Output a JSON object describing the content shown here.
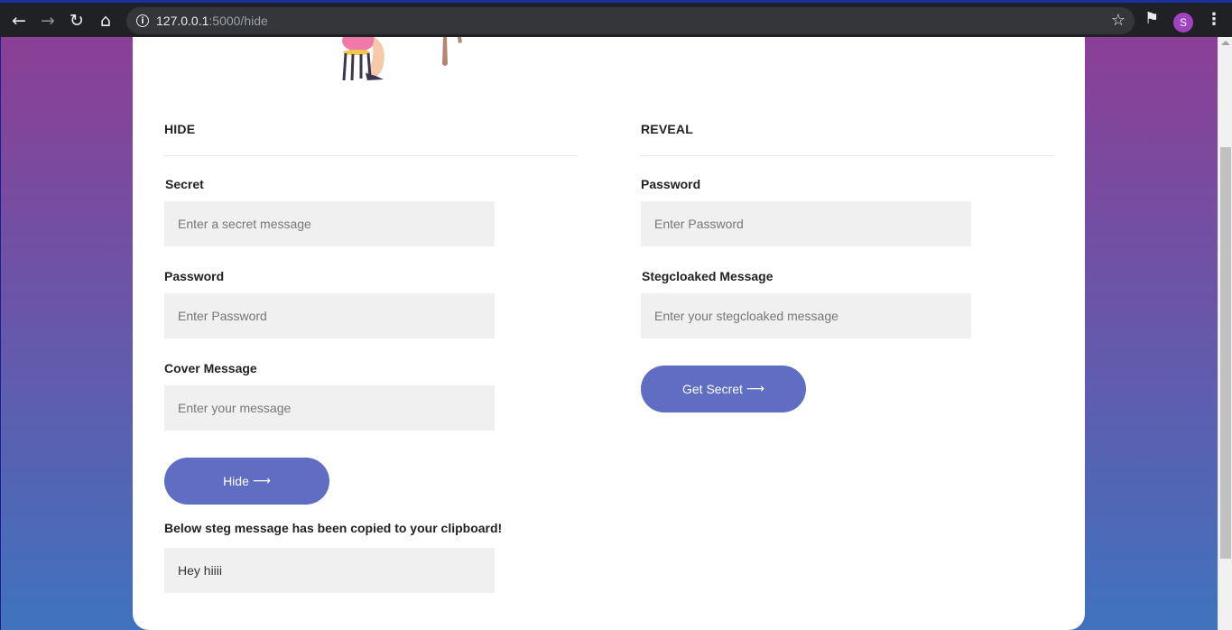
{
  "browser": {
    "url_host": "127.0.0.1",
    "url_path": ":5000/hide",
    "profile_initial": "S",
    "icons": {
      "back": "back-arrow-icon",
      "forward": "forward-arrow-icon",
      "reload": "reload-icon",
      "home": "home-icon",
      "info": "info-icon",
      "star": "star-icon",
      "extensions": "puzzle-icon",
      "menu": "kebab-menu-icon"
    }
  },
  "hide": {
    "title": "HIDE",
    "secret_label": "Secret",
    "secret_placeholder": "Enter a secret message",
    "password_label": "Password",
    "password_placeholder": "Enter Password",
    "cover_label": "Cover Message",
    "cover_placeholder": "Enter your message",
    "button_label": "Hide",
    "result_notice": "Below steg message has been copied to your clipboard!",
    "result_value": "Hey hiiii"
  },
  "reveal": {
    "title": "REVEAL",
    "password_label": "Password",
    "password_placeholder": "Enter Password",
    "message_label": "Stegcloaked Message",
    "message_placeholder": "Enter your stegcloaked message",
    "button_label": "Get Secret"
  },
  "colors": {
    "accent": "#5f6dc3",
    "gradient_top": "#8b3f95",
    "gradient_bottom": "#3f73bf"
  }
}
